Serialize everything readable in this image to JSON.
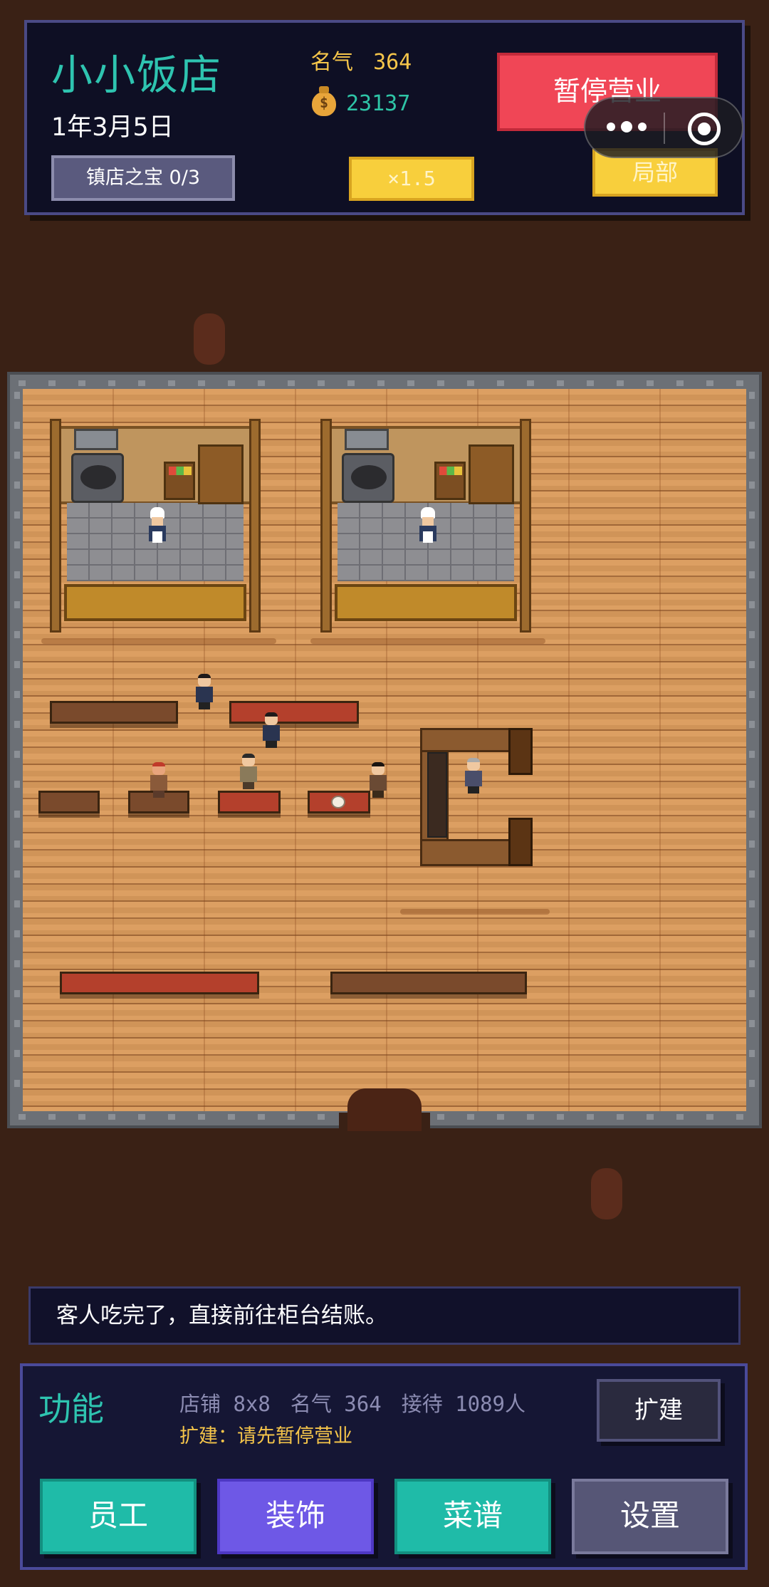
{
  "hud": {
    "shop_name": "小小饭店",
    "date": "1年3月5日",
    "fame_label": "名气",
    "fame_value": "364",
    "money_icon": "money-bag-icon",
    "money_value": "23137",
    "treasure_label": "镇店之宝 0/3",
    "speed_label": "×1.5",
    "pause_label": "暂停营业",
    "local_label": "局部"
  },
  "message": "客人吃完了，直接前往柜台结账。",
  "panel": {
    "title": "功能",
    "stat_shop": "店铺 8x8",
    "stat_fame": "名气 364",
    "stat_served": "接待 1089人",
    "expand_hint": "扩建：请先暂停营业",
    "expand_label": "扩建",
    "buttons": {
      "staff": "员工",
      "decor": "装饰",
      "menu": "菜谱",
      "settings": "设置"
    }
  },
  "colors": {
    "accent_teal": "#2ec4b0",
    "accent_yellow": "#f8cf3c",
    "accent_red": "#f04656",
    "accent_purple": "#6e58e6",
    "floor": "#d99a5c"
  }
}
